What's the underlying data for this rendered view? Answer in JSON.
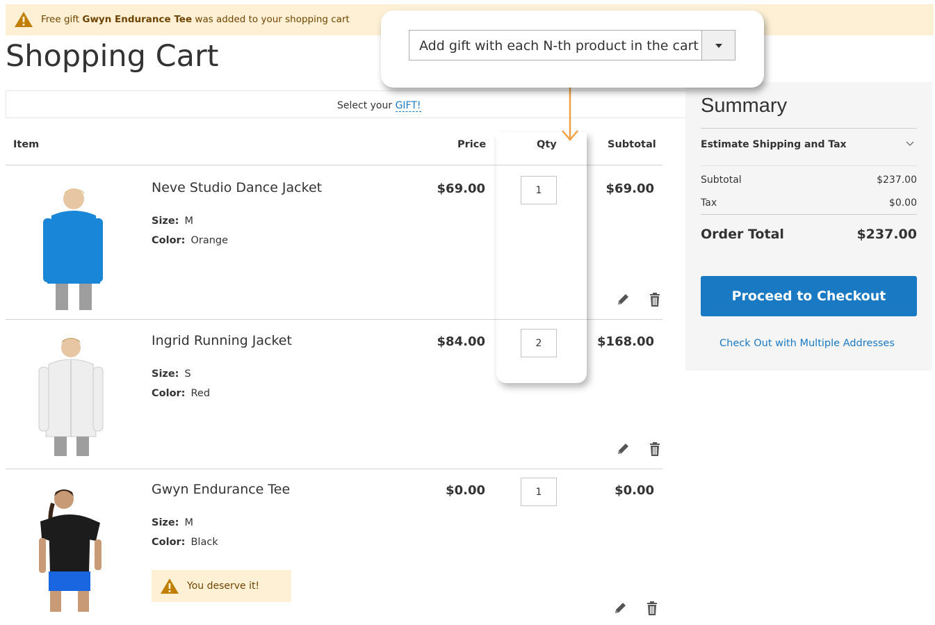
{
  "notice": {
    "prefix": "Free gift ",
    "product": "Gwyn Endurance Tee",
    "suffix": " was added to your shopping cart"
  },
  "page_title": "Shopping Cart",
  "gift_bar": {
    "prefix": "Select your ",
    "link": "GIFT!"
  },
  "table_headers": {
    "item": "Item",
    "price": "Price",
    "qty": "Qty",
    "subtotal": "Subtotal"
  },
  "items": [
    {
      "name": "Neve Studio Dance Jacket",
      "size_label": "Size:",
      "size": "M",
      "color_label": "Color:",
      "color": "Orange",
      "price": "$69.00",
      "qty": "1",
      "subtotal": "$69.00",
      "shirt_color": "#1a86d8"
    },
    {
      "name": "Ingrid Running Jacket",
      "size_label": "Size:",
      "size": "S",
      "color_label": "Color:",
      "color": "Red",
      "price": "$84.00",
      "qty": "2",
      "subtotal": "$168.00",
      "shirt_color": "#eeeeee"
    },
    {
      "name": "Gwyn Endurance Tee",
      "size_label": "Size:",
      "size": "M",
      "color_label": "Color:",
      "color": "Black",
      "price": "$0.00",
      "qty": "1",
      "subtotal": "$0.00",
      "shirt_color": "#1c1c1c",
      "gift_message": "You deserve it!"
    }
  ],
  "summary": {
    "title": "Summary",
    "estimate": "Estimate Shipping and Tax",
    "subtotal_label": "Subtotal",
    "subtotal_value": "$237.00",
    "tax_label": "Tax",
    "tax_value": "$0.00",
    "total_label": "Order Total",
    "total_value": "$237.00",
    "checkout_button": "Proceed to Checkout",
    "multi_address_link": "Check Out with Multiple Addresses"
  },
  "callout": {
    "select_value": "Add gift with each N-th product in the cart"
  },
  "colors": {
    "accent": "#1979c3",
    "notice_bg": "#fdf0d5",
    "warning": "#c07f00",
    "arrow": "#f0a040"
  },
  "icons": [
    "warning-icon",
    "pencil-icon",
    "trash-icon",
    "chevron-down-icon",
    "dropdown-caret-icon"
  ]
}
